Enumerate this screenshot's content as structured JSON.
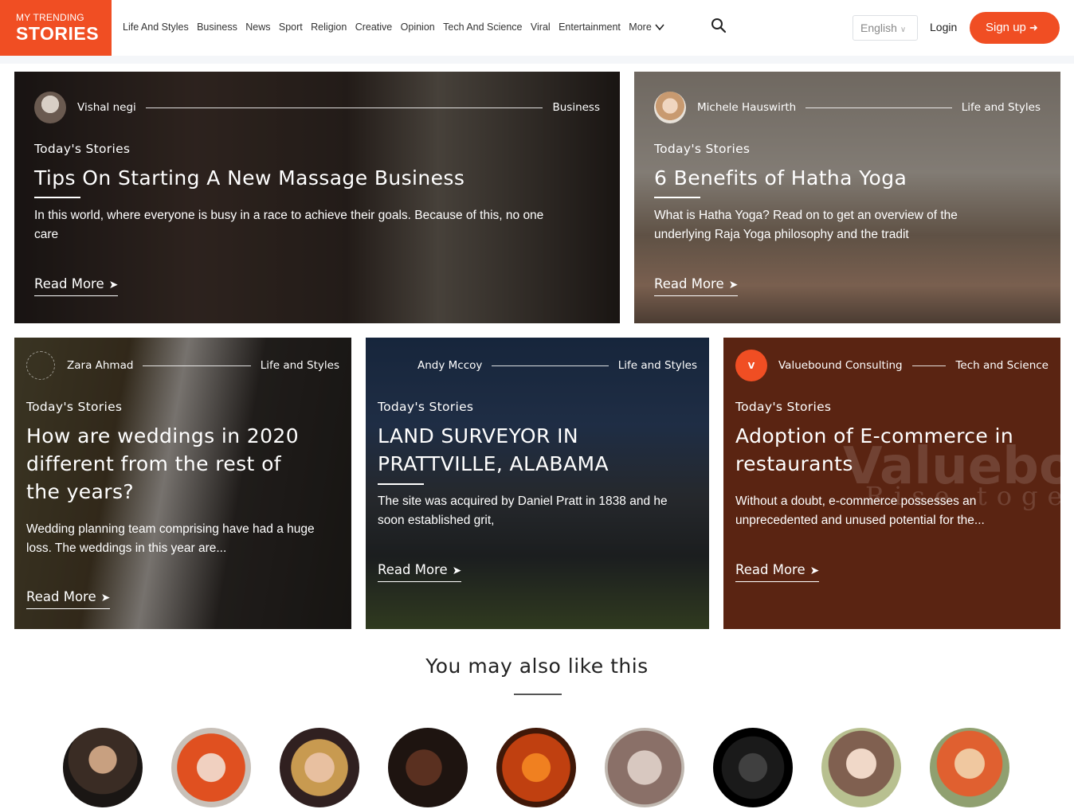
{
  "logo": {
    "line1": "MY TRENDING",
    "line2": "STORIES"
  },
  "nav": {
    "items": [
      "Life And Styles",
      "Business",
      "News",
      "Sport",
      "Religion",
      "Creative",
      "Opinion",
      "Tech And Science",
      "Viral",
      "Entertainment"
    ],
    "more_label": "More"
  },
  "header": {
    "language": "English",
    "login_label": "Login",
    "signup_label": "Sign up"
  },
  "cards": [
    {
      "author": "Vishal negi",
      "category": "Business",
      "kicker": "Today's Stories",
      "title": "Tips On Starting A New Massage Business",
      "description": "In this world, where everyone is busy in a race to achieve their goals. Because of this, no one care",
      "read_more": "Read More",
      "bg_color": "#3a2c26"
    },
    {
      "author": "Michele Hauswirth",
      "category": "Life and Styles",
      "kicker": "Today's Stories",
      "title": "6 Benefits of Hatha Yoga",
      "description": "What is Hatha Yoga? Read on to get an overview of the underlying Raja Yoga philosophy and the tradit",
      "read_more": "Read More",
      "bg_color": "#8b7a6c"
    },
    {
      "author": "Zara Ahmad",
      "category": "Life and Styles",
      "kicker": "Today's Stories",
      "title": "How are weddings in 2020 different from the rest of the years?",
      "description": "Wedding planning team comprising have had a huge loss. The weddings in this year are...",
      "read_more": "Read More",
      "bg_color": "#4a4030"
    },
    {
      "author": "Andy Mccoy",
      "category": "Life and Styles",
      "kicker": "Today's Stories",
      "title": "LAND SURVEYOR IN PRATTVILLE, ALABAMA",
      "description": "The site was acquired by Daniel Pratt in 1838 and he soon established grit,",
      "read_more": "Read More",
      "bg_color": "#2c3a4e"
    },
    {
      "author": "Valuebound Consulting",
      "category": "Tech and Science",
      "kicker": "Today's Stories",
      "title": "Adoption of E-commerce in restaurants",
      "description": "Without a doubt, e-commerce possesses an unprecedented and unused potential for the...",
      "read_more": "Read More",
      "bg_color": "#5a2412",
      "watermark_big": "Valuebo",
      "watermark_small": "Rise toget",
      "avatar_text": "V"
    }
  ],
  "also_like": {
    "title": "You may also like this",
    "avatars": [
      "person-1",
      "person-2",
      "person-3",
      "person-4",
      "person-5",
      "person-6",
      "person-7",
      "person-8",
      "person-9"
    ]
  },
  "colors": {
    "brand": "#f04e23"
  }
}
